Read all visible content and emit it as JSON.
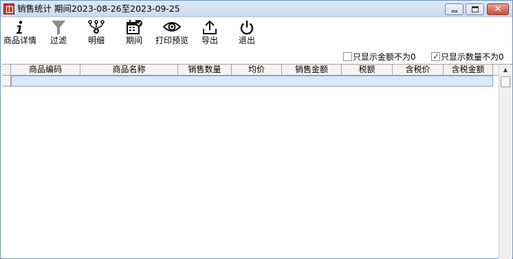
{
  "window": {
    "title": "销售统计 期间2023-08-26至2023-09-25",
    "close_glyph": "✕"
  },
  "toolbar": {
    "items": [
      {
        "label": "商品详情",
        "icon": "info-icon"
      },
      {
        "label": "过滤",
        "icon": "filter-icon"
      },
      {
        "label": "明细",
        "icon": "hierarchy-gear-icon"
      },
      {
        "label": "期间",
        "icon": "calendar-check-icon"
      },
      {
        "label": "打印预览",
        "icon": "eye-icon"
      },
      {
        "label": "导出",
        "icon": "upload-icon"
      },
      {
        "label": "退出",
        "icon": "power-icon"
      }
    ]
  },
  "options": {
    "amount_nonzero": {
      "label": "只显示金额不为0",
      "checked": false
    },
    "quantity_nonzero": {
      "label": "只显示数量不为0",
      "checked": true
    }
  },
  "table": {
    "columns": [
      "商品编码",
      "商品名称",
      "销售数量",
      "均价",
      "销售金额",
      "税额",
      "含税价",
      "含税金额"
    ],
    "rows": []
  },
  "colors": {
    "accent": "#d0342c",
    "selection": "#dbe8f8"
  }
}
